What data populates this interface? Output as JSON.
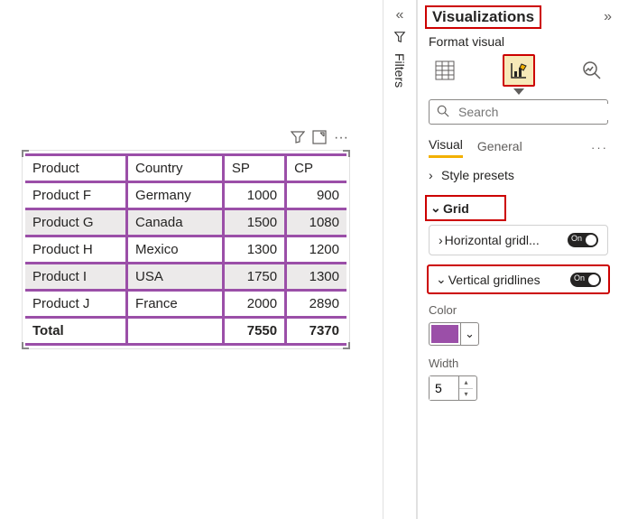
{
  "canvas": {
    "actions": {
      "filter": "⧩",
      "focus": "⤢",
      "more": "···"
    },
    "table": {
      "headers": [
        "Product",
        "Country",
        "SP",
        "CP"
      ],
      "rows": [
        {
          "cells": [
            "Product F",
            "Germany",
            "1000",
            "900"
          ],
          "alt": false
        },
        {
          "cells": [
            "Product G",
            "Canada",
            "1500",
            "1080"
          ],
          "alt": true
        },
        {
          "cells": [
            "Product H",
            "Mexico",
            "1300",
            "1200"
          ],
          "alt": false
        },
        {
          "cells": [
            "Product I",
            "USA",
            "1750",
            "1300"
          ],
          "alt": true
        },
        {
          "cells": [
            "Product J",
            "France",
            "2000",
            "2890"
          ],
          "alt": false
        }
      ],
      "total": {
        "label": "Total",
        "values": [
          "7550",
          "7370"
        ]
      }
    },
    "gridline_color": "#9b4fa8"
  },
  "filters_label": "Filters",
  "panel": {
    "title": "Visualizations",
    "subtitle": "Format visual",
    "search_placeholder": "Search",
    "tabs": {
      "visual": "Visual",
      "general": "General"
    },
    "sections": {
      "style_presets": "Style presets",
      "grid": "Grid",
      "horizontal": {
        "label": "Horizontal gridl...",
        "toggle": "On"
      },
      "vertical": {
        "label": "Vertical gridlines",
        "toggle": "On"
      },
      "color_label": "Color",
      "color_value": "#9b4fa8",
      "width_label": "Width",
      "width_value": "5"
    }
  }
}
